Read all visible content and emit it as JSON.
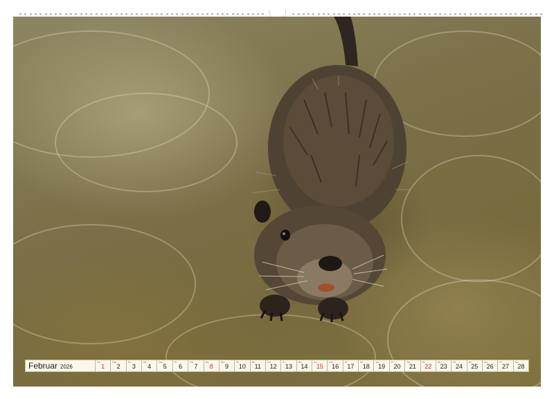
{
  "calendar": {
    "month": "Februar",
    "year": "2026",
    "days": [
      {
        "wd": "So",
        "d": "1",
        "sunday": true
      },
      {
        "wd": "Mo",
        "d": "2"
      },
      {
        "wd": "Di",
        "d": "3"
      },
      {
        "wd": "Mi",
        "d": "4"
      },
      {
        "wd": "Do",
        "d": "5"
      },
      {
        "wd": "Fr",
        "d": "6"
      },
      {
        "wd": "Sa",
        "d": "7"
      },
      {
        "wd": "So",
        "d": "8",
        "sunday": true
      },
      {
        "wd": "Mo",
        "d": "9"
      },
      {
        "wd": "Di",
        "d": "10"
      },
      {
        "wd": "Mi",
        "d": "11"
      },
      {
        "wd": "Do",
        "d": "12"
      },
      {
        "wd": "Fr",
        "d": "13"
      },
      {
        "wd": "Sa",
        "d": "14"
      },
      {
        "wd": "So",
        "d": "15",
        "sunday": true
      },
      {
        "wd": "Mo",
        "d": "16"
      },
      {
        "wd": "Di",
        "d": "17"
      },
      {
        "wd": "Mi",
        "d": "18"
      },
      {
        "wd": "Do",
        "d": "19"
      },
      {
        "wd": "Fr",
        "d": "20"
      },
      {
        "wd": "Sa",
        "d": "21"
      },
      {
        "wd": "So",
        "d": "22",
        "sunday": true
      },
      {
        "wd": "Mo",
        "d": "23"
      },
      {
        "wd": "Di",
        "d": "24"
      },
      {
        "wd": "Mi",
        "d": "25"
      },
      {
        "wd": "Do",
        "d": "26"
      },
      {
        "wd": "Fr",
        "d": "27"
      },
      {
        "wd": "Sa",
        "d": "28"
      }
    ]
  },
  "colors": {
    "sunday": "#c9302c",
    "strip_bg": "#fbf7ea",
    "water": "#7b7048",
    "fur": "#4e4232"
  },
  "photo": {
    "subject": "nutria-icon"
  }
}
